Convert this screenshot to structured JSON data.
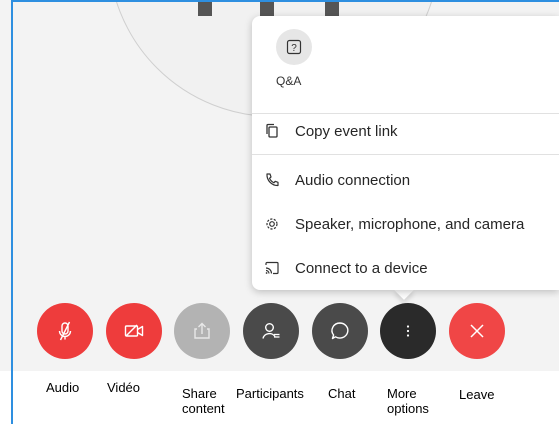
{
  "menu": {
    "qa_label": "Q&A",
    "items": [
      {
        "id": "copy-event-link",
        "label": "Copy event link",
        "icon": "copy-icon"
      },
      {
        "id": "audio-connection",
        "label": "Audio connection",
        "icon": "phone-icon"
      },
      {
        "id": "speaker-microphone-camera",
        "label": "Speaker, microphone, and camera",
        "icon": "gear-icon"
      },
      {
        "id": "connect-to-device",
        "label": "Connect to a device",
        "icon": "cast-icon"
      }
    ]
  },
  "controls": [
    {
      "id": "audio",
      "label": "Audio",
      "icon": "muted-microphone-icon",
      "color": "#ee3c3c"
    },
    {
      "id": "video",
      "label": "Vidéo",
      "icon": "video-off-icon",
      "color": "#ee3c3c"
    },
    {
      "id": "share",
      "label": "Share\ncontent",
      "icon": "share-icon",
      "color": "#b3b3b3"
    },
    {
      "id": "participants",
      "label": "Participants",
      "icon": "participants-icon",
      "color": "#4a4a4a"
    },
    {
      "id": "chat",
      "label": "Chat",
      "icon": "chat-bubble-icon",
      "color": "#4a4a4a"
    },
    {
      "id": "more",
      "label": "More\noptions",
      "icon": "more-dots-icon",
      "color": "#2a2a2a"
    },
    {
      "id": "leave",
      "label": "Leave",
      "icon": "close-icon",
      "color": "#f04646"
    }
  ]
}
